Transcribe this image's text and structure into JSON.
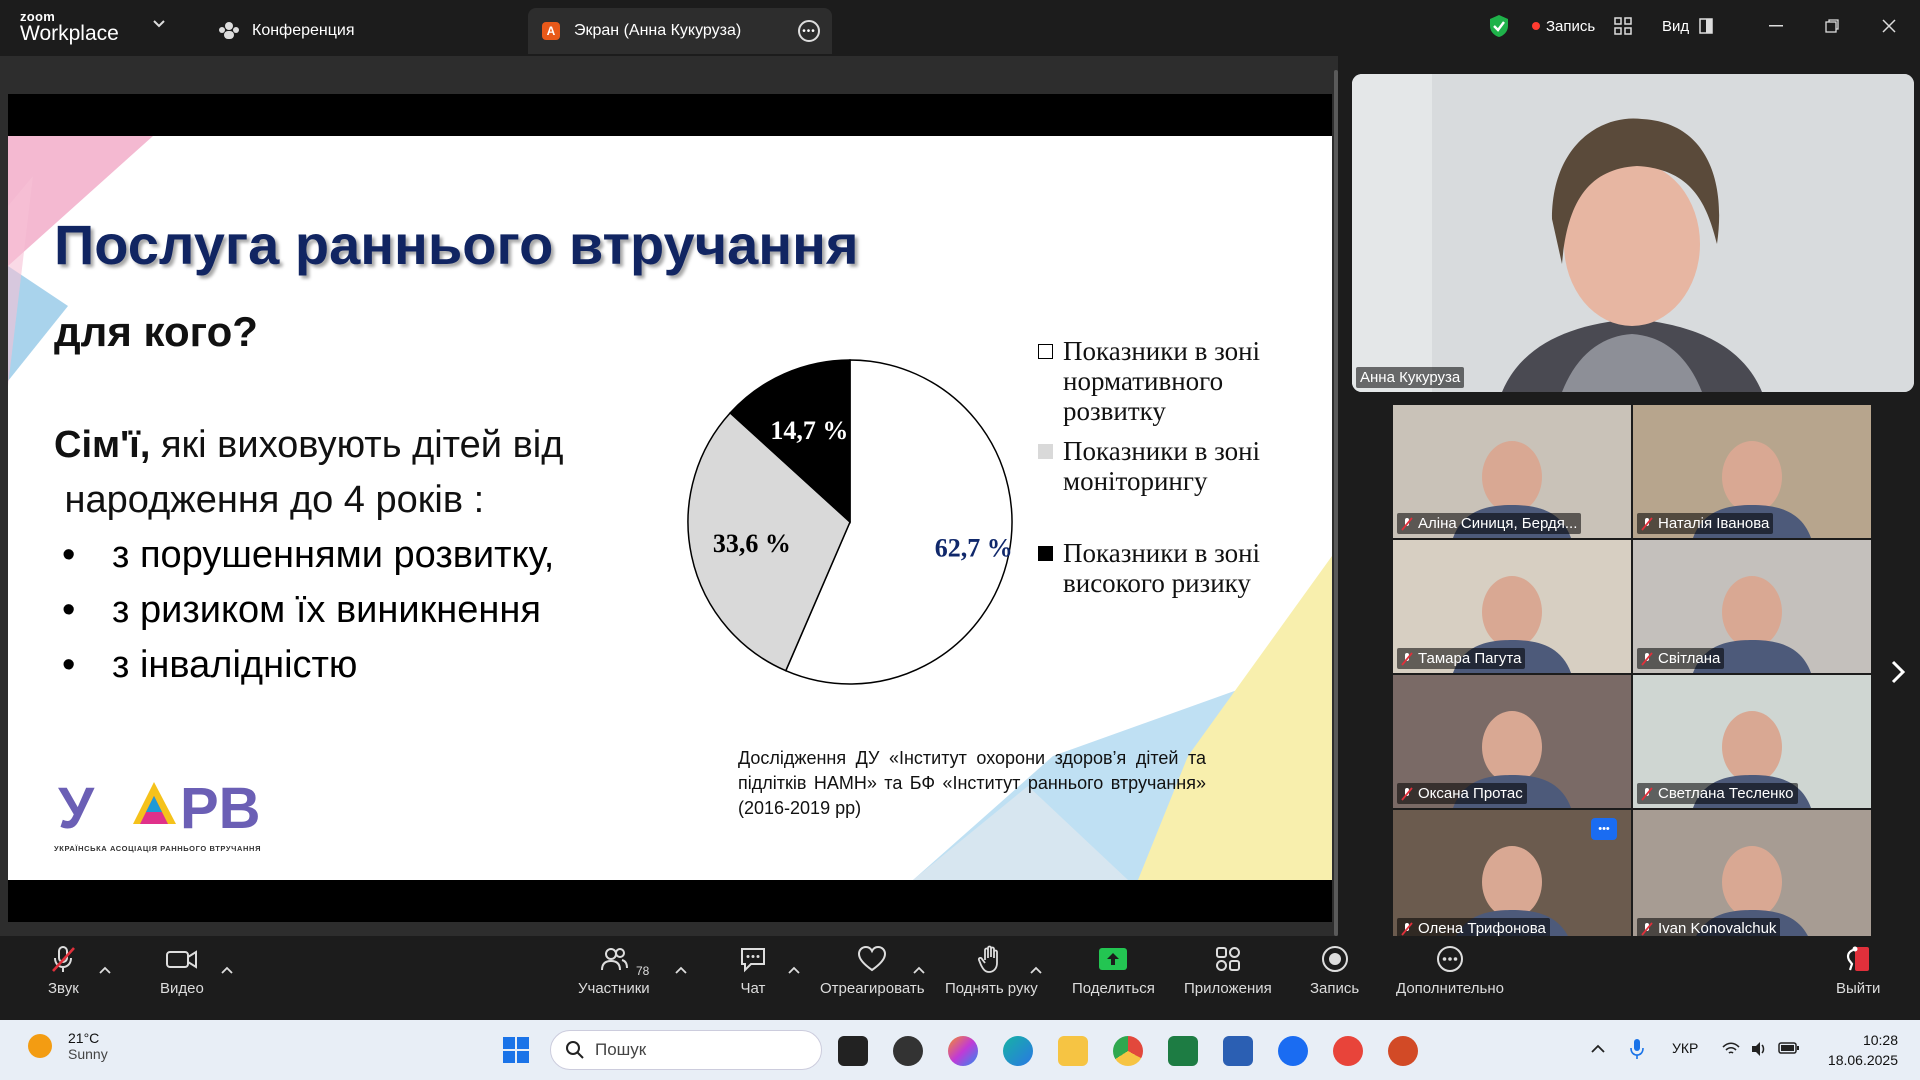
{
  "app": {
    "logo_top": "zoom",
    "logo_bottom": "Workplace"
  },
  "tabs": [
    {
      "label": "Конференция"
    },
    {
      "label": "Экран (Анна Кукуруза)",
      "avatar_letter": "А"
    }
  ],
  "header": {
    "record_label": "Запись",
    "view_label": "Вид"
  },
  "slide": {
    "title": "Послуга раннього втручання",
    "subtitle": "для кого?",
    "intro_bold": "Сім'ї,",
    "intro_rest": " які виховують дітей від",
    "intro_line2": " народження до 4 років :",
    "bullets": [
      "з порушеннями розвитку,",
      "з ризиком їх виникнення",
      "з інвалідністю"
    ],
    "source": "Дослідження ДУ «Інститут охорони здоров’я дітей та підлітків НАМН» та БФ «Інститут раннього втручання» (2016-2019 рр)",
    "logo_text": "УАРВ",
    "logo_caption": "УКРАЇНСЬКА АСОЦІАЦІЯ РАННЬОГО ВТРУЧАННЯ"
  },
  "chart_data": {
    "type": "pie",
    "slices": [
      {
        "label": "Показники в зоні нормативного розвитку",
        "legend_lines": [
          "Показники в зоні",
          "нормативного",
          "розвитку"
        ],
        "value": 62.7,
        "value_label": "62,7 %",
        "color": "#ffffff",
        "legend_marker": "□"
      },
      {
        "label": "Показники в зоні моніторингу",
        "legend_lines": [
          "Показники в зоні",
          "моніторингу"
        ],
        "value": 33.6,
        "value_label": "33,6 %",
        "color": "#d9d9d9",
        "legend_marker": "■"
      },
      {
        "label": "Показники в зоні високого ризику",
        "legend_lines": [
          "Показники в зоні",
          "високого ризику"
        ],
        "value": 14.7,
        "value_label": "14,7 %",
        "color": "#000000",
        "legend_marker": "■"
      }
    ]
  },
  "speaker": {
    "name": "Анна Кукуруза"
  },
  "participants": [
    {
      "name": "Аліна Синиця, Бердя..."
    },
    {
      "name": "Наталія Іванова"
    },
    {
      "name": "Тамара Пагута"
    },
    {
      "name": "Світлана"
    },
    {
      "name": "Оксана Протас"
    },
    {
      "name": "Светлана Тесленко"
    },
    {
      "name": "Олена Трифонова"
    },
    {
      "name": "Ivan Konovalchuk"
    }
  ],
  "toolbar": {
    "audio": "Звук",
    "video": "Видео",
    "participants": "Участники",
    "participants_count": "78",
    "chat": "Чат",
    "react": "Отреагировать",
    "raise_hand": "Поднять руку",
    "share": "Поделиться",
    "apps": "Приложения",
    "record": "Запись",
    "more": "Дополнительно",
    "leave": "Выйти"
  },
  "taskbar": {
    "temperature": "21°C",
    "weather": "Sunny",
    "search_placeholder": "Пошук",
    "language": "УКР",
    "time": "10:28",
    "date": "18.06.2025"
  }
}
